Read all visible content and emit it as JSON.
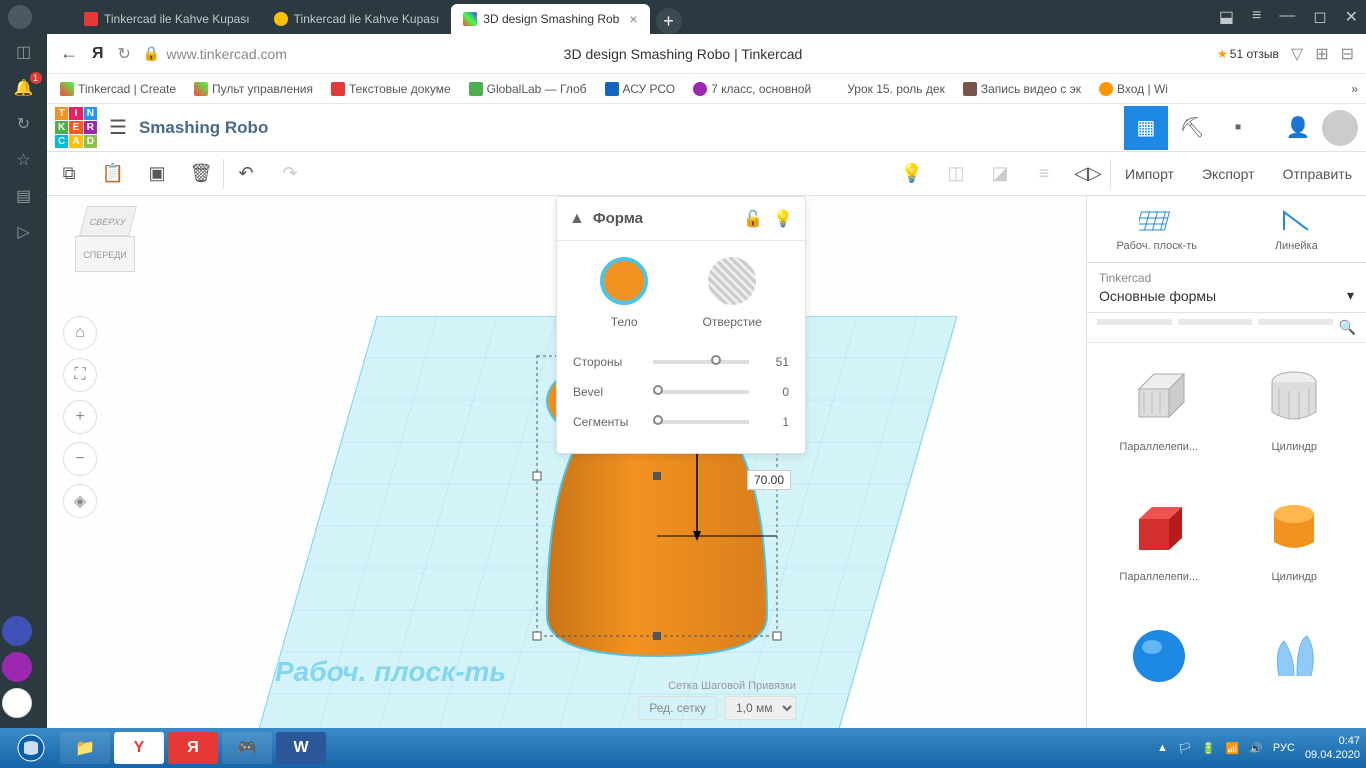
{
  "browser": {
    "tabs": [
      {
        "label": "Tinkercad ile Kahve Kupası",
        "active": false
      },
      {
        "label": "Tinkercad ile Kahve Kupası",
        "active": false
      },
      {
        "label": "3D design Smashing Rob",
        "active": true
      }
    ],
    "url": "www.tinkercad.com",
    "page_title": "3D design Smashing Robo | Tinkercad",
    "rating": "51 отзыв"
  },
  "bookmarks": [
    "Tinkercad | Create",
    "Пульт управления",
    "Текстовые докуме",
    "GlobalLab — Глоб",
    "АСУ РСО",
    "7 класс, основной",
    "Урок 15. роль дек",
    "Запись видео с эк",
    "Вход | Wi"
  ],
  "tinkercad": {
    "project_name": "Smashing Robo",
    "toolbar_right": {
      "import": "Импорт",
      "export": "Экспорт",
      "send": "Отправить"
    },
    "viewcube": {
      "top": "СВЕРХУ",
      "front": "СПЕРЕДИ"
    },
    "dimension": "70.00",
    "workplane_label": "Рабоч. плоск-ть",
    "snap_label": "Сетка Шаговой Привязки",
    "snap_value": "1,0 мм",
    "edit_grid": "Ред. сетку"
  },
  "shape_panel": {
    "title": "Форма",
    "solid": "Тело",
    "hole": "Отверстие",
    "props": [
      {
        "name": "Стороны",
        "value": "51",
        "pos": 60
      },
      {
        "name": "Bevel",
        "value": "0",
        "pos": 0
      },
      {
        "name": "Сегменты",
        "value": "1",
        "pos": 0
      }
    ]
  },
  "sidebar": {
    "tool1": "Рабоч. плоск-ть",
    "tool2": "Линейка",
    "cat_label": "Tinkercad",
    "cat_name": "Основные формы",
    "shapes": [
      {
        "name": "Параллелепи...",
        "color": "#c8c8c8",
        "kind": "box-striped"
      },
      {
        "name": "Цилиндр",
        "color": "#c8c8c8",
        "kind": "cyl-striped"
      },
      {
        "name": "Параллелепи...",
        "color": "#d32f2f",
        "kind": "box"
      },
      {
        "name": "Цилиндр",
        "color": "#f29220",
        "kind": "cyl"
      },
      {
        "name": "",
        "color": "#1e88e5",
        "kind": "sphere"
      },
      {
        "name": "",
        "color": "#64b5f6",
        "kind": "organic"
      }
    ]
  },
  "taskbar": {
    "lang": "РУС",
    "time": "0:47",
    "date": "09.04.2020"
  }
}
